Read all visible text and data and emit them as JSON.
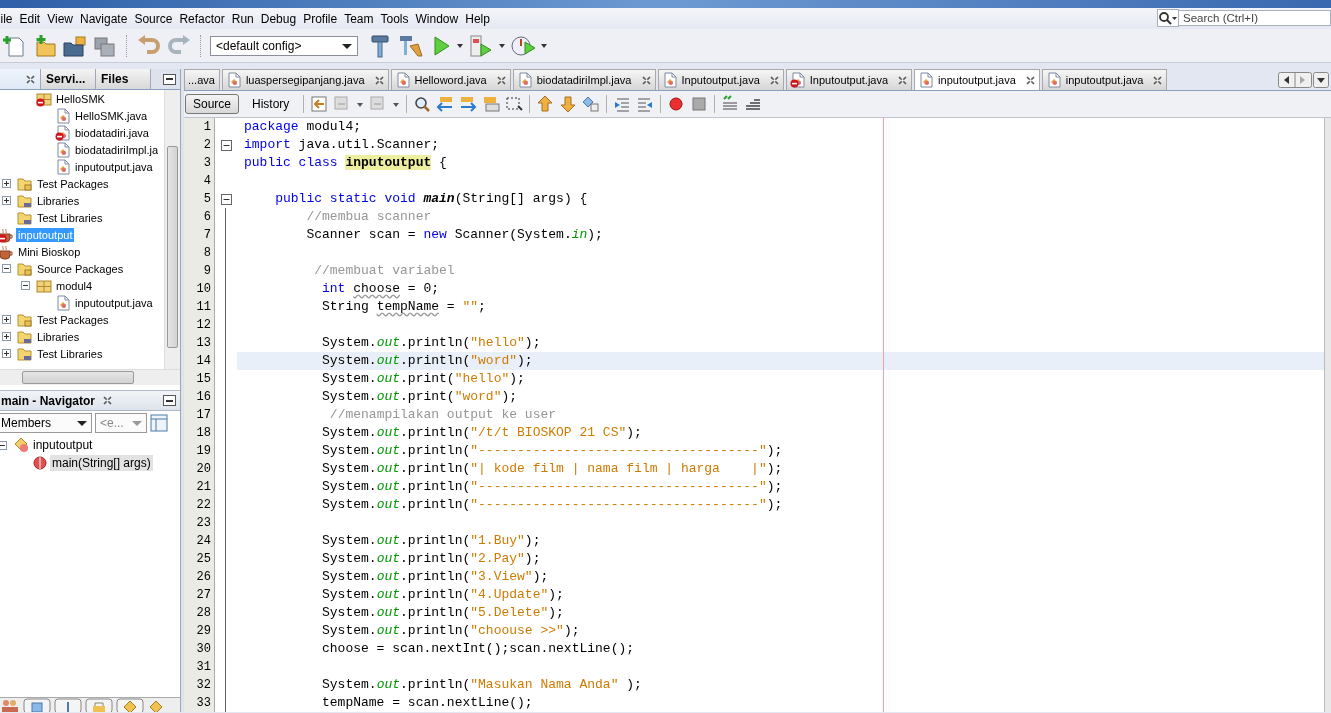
{
  "menu_bar": {
    "items": [
      "ile",
      "Edit",
      "View",
      "Navigate",
      "Source",
      "Refactor",
      "Run",
      "Debug",
      "Profile",
      "Team",
      "Tools",
      "Window",
      "Help"
    ],
    "search": {
      "placeholder": "Search (Ctrl+I)"
    }
  },
  "toolbar": {
    "config": "<default config>"
  },
  "projects_panel": {
    "tabs": [
      {
        "selected": true
      },
      {
        "label": "Servi...",
        "selected": false
      },
      {
        "label": "Files",
        "selected": false
      }
    ],
    "tree": [
      {
        "children": [
          {
            "children": [
              {
                "label": "HelloSMK",
                "kind": "package",
                "selected": false,
                "error": true,
                "children": [
                  {
                    "label": "HelloSMK.java",
                    "kind": "file",
                    "selected": false,
                    "error": false
                  },
                  {
                    "label": "biodatadiri.java",
                    "kind": "file",
                    "selected": false,
                    "error": true
                  },
                  {
                    "label": "biodatadiriImpl.ja",
                    "kind": "file",
                    "selected": false,
                    "error": false
                  },
                  {
                    "label": "inputoutput.java",
                    "kind": "file",
                    "selected": false,
                    "error": false
                  }
                ]
              }
            ]
          },
          {
            "label": "Test Packages",
            "kind": "folder",
            "expanded": false,
            "selected": false,
            "error": false
          },
          {
            "label": "Libraries",
            "kind": "library",
            "expanded": false,
            "selected": false,
            "error": false
          },
          {
            "label": "Test Libraries",
            "kind": "library",
            "selected": false,
            "error": false
          }
        ]
      },
      {
        "label": "inputoutput",
        "kind": "project",
        "selected": true,
        "error": true
      },
      {
        "label": "Mini Bioskop",
        "kind": "project",
        "selected": false,
        "error": false,
        "children": [
          {
            "label": "Source Packages",
            "kind": "folder",
            "expanded": true,
            "selected": false,
            "error": false,
            "children": [
              {
                "label": "modul4",
                "kind": "package",
                "expanded": true,
                "selected": false,
                "error": false,
                "children": [
                  {
                    "label": "inputoutput.java",
                    "kind": "file",
                    "selected": false,
                    "error": false
                  }
                ]
              }
            ]
          },
          {
            "label": "Test Packages",
            "kind": "folder",
            "expanded": false,
            "selected": false,
            "error": false
          },
          {
            "label": "Libraries",
            "kind": "library",
            "expanded": false,
            "selected": false,
            "error": false
          },
          {
            "label": "Test Libraries",
            "kind": "library",
            "expanded": false,
            "selected": false,
            "error": false
          }
        ]
      }
    ]
  },
  "navigator": {
    "title": "main - Navigator",
    "filter": "Members",
    "filter_2": "<e...",
    "tree": [
      {
        "label": "inputoutput",
        "kind": "class",
        "expanded": true,
        "selected": false,
        "error": false,
        "children": [
          {
            "label": "main(String[] args)",
            "kind": "method",
            "selected": true,
            "error": false
          }
        ]
      }
    ]
  },
  "editor": {
    "tabs": [
      {
        "label": "...ava",
        "selected": false
      },
      {
        "label": "luaspersegipanjang.java",
        "selected": false,
        "error": false
      },
      {
        "label": "Helloword.java",
        "selected": false,
        "error": false
      },
      {
        "label": "biodatadiriImpl.java",
        "selected": false,
        "error": false
      },
      {
        "label": "Inputoutput.java",
        "selected": false,
        "error": false
      },
      {
        "label": "Inputoutput.java",
        "selected": false,
        "error": true
      },
      {
        "label": "inputoutput.java",
        "selected": true,
        "error": false
      },
      {
        "label": "inputoutput.java",
        "selected": false,
        "error": false
      }
    ],
    "views": [
      {
        "label": "Source",
        "selected": true
      },
      {
        "label": "History",
        "selected": false
      }
    ],
    "lines": [
      {
        "number": "1",
        "current": false,
        "fold": false,
        "tokens": [
          {
            "kind": "keyword",
            "text": "package"
          },
          {
            "kind": "plain",
            "text": " modul4;"
          }
        ]
      },
      {
        "number": "2",
        "current": false,
        "fold": true,
        "tokens": [
          {
            "kind": "keyword",
            "text": "import"
          },
          {
            "kind": "plain",
            "text": " java.util.Scanner;"
          }
        ]
      },
      {
        "number": "3",
        "current": false,
        "fold": false,
        "tokens": [
          {
            "kind": "keyword",
            "text": "public class "
          },
          {
            "kind": "highlight",
            "text": "inputoutput"
          },
          {
            "kind": "plain",
            "text": " {"
          }
        ]
      },
      {
        "number": "4",
        "current": false,
        "fold": false
      },
      {
        "number": "5",
        "current": false,
        "fold": true,
        "tokens": [
          {
            "kind": "keyword",
            "text": "    public static void "
          },
          {
            "kind": "method",
            "text": "main"
          },
          {
            "kind": "plain",
            "text": "(String[] args) {"
          }
        ]
      },
      {
        "number": "6",
        "current": false,
        "fold": false,
        "tokens": [
          {
            "kind": "comment",
            "text": "        //membua scanner"
          }
        ]
      },
      {
        "number": "7",
        "current": false,
        "fold": false,
        "tokens": [
          {
            "kind": "plain",
            "text": "        Scanner scan = "
          },
          {
            "kind": "keyword",
            "text": "new"
          },
          {
            "kind": "plain",
            "text": " Scanner(System."
          },
          {
            "kind": "field",
            "text": "in"
          },
          {
            "kind": "plain",
            "text": ");"
          }
        ]
      },
      {
        "number": "8",
        "current": false,
        "fold": false
      },
      {
        "number": "9",
        "current": false,
        "fold": false,
        "tokens": [
          {
            "kind": "comment",
            "text": "         //membuat variabel"
          }
        ]
      },
      {
        "number": "10",
        "current": false,
        "fold": false,
        "tokens": [
          {
            "kind": "keyword",
            "text": "          int "
          },
          {
            "kind": "warning",
            "text": "choose"
          },
          {
            "kind": "plain",
            "text": " = 0;"
          }
        ]
      },
      {
        "number": "11",
        "current": false,
        "fold": false,
        "tokens": [
          {
            "kind": "plain",
            "text": "          String "
          },
          {
            "kind": "warning",
            "text": "tempName"
          },
          {
            "kind": "plain",
            "text": " = "
          },
          {
            "kind": "string",
            "text": "\"\""
          },
          {
            "kind": "plain",
            "text": ";"
          }
        ]
      },
      {
        "number": "12",
        "current": false,
        "fold": false
      },
      {
        "number": "13",
        "current": false,
        "fold": false,
        "tokens": [
          {
            "kind": "plain",
            "text": "          System."
          },
          {
            "kind": "field",
            "text": "out"
          },
          {
            "kind": "plain",
            "text": ".println("
          },
          {
            "kind": "string",
            "text": "\"hello\""
          },
          {
            "kind": "plain",
            "text": ");"
          }
        ]
      },
      {
        "number": "14",
        "current": true,
        "fold": false,
        "tokens": [
          {
            "kind": "plain",
            "text": "          System."
          },
          {
            "kind": "field",
            "text": "out"
          },
          {
            "kind": "plain",
            "text": ".println("
          },
          {
            "kind": "string",
            "text": "\"word\""
          },
          {
            "kind": "plain",
            "text": ");"
          }
        ]
      },
      {
        "number": "15",
        "current": false,
        "fold": false,
        "tokens": [
          {
            "kind": "plain",
            "text": "          System."
          },
          {
            "kind": "field",
            "text": "out"
          },
          {
            "kind": "plain",
            "text": ".print("
          },
          {
            "kind": "string",
            "text": "\"hello\""
          },
          {
            "kind": "plain",
            "text": ");"
          }
        ]
      },
      {
        "number": "16",
        "current": false,
        "fold": false,
        "tokens": [
          {
            "kind": "plain",
            "text": "          System."
          },
          {
            "kind": "field",
            "text": "out"
          },
          {
            "kind": "plain",
            "text": ".print("
          },
          {
            "kind": "string",
            "text": "\"word\""
          },
          {
            "kind": "plain",
            "text": ");"
          }
        ]
      },
      {
        "number": "17",
        "current": false,
        "fold": false,
        "tokens": [
          {
            "kind": "comment",
            "text": "           //menampilakan output ke user"
          }
        ]
      },
      {
        "number": "18",
        "current": false,
        "fold": false,
        "tokens": [
          {
            "kind": "plain",
            "text": "          System."
          },
          {
            "kind": "field",
            "text": "out"
          },
          {
            "kind": "plain",
            "text": ".println("
          },
          {
            "kind": "string",
            "text": "\"/t/t BIOSKOP 21 CS\""
          },
          {
            "kind": "plain",
            "text": ");"
          }
        ]
      },
      {
        "number": "19",
        "current": false,
        "fold": false,
        "tokens": [
          {
            "kind": "plain",
            "text": "          System."
          },
          {
            "kind": "field",
            "text": "out"
          },
          {
            "kind": "plain",
            "text": ".println("
          },
          {
            "kind": "string",
            "text": "\"------------------------------------\""
          },
          {
            "kind": "plain",
            "text": ");"
          }
        ]
      },
      {
        "number": "20",
        "current": false,
        "fold": false,
        "tokens": [
          {
            "kind": "plain",
            "text": "          System."
          },
          {
            "kind": "field",
            "text": "out"
          },
          {
            "kind": "plain",
            "text": ".println("
          },
          {
            "kind": "string",
            "text": "\"| kode film | nama film | harga    |\""
          },
          {
            "kind": "plain",
            "text": ");"
          }
        ]
      },
      {
        "number": "21",
        "current": false,
        "fold": false,
        "tokens": [
          {
            "kind": "plain",
            "text": "          System."
          },
          {
            "kind": "field",
            "text": "out"
          },
          {
            "kind": "plain",
            "text": ".println("
          },
          {
            "kind": "string",
            "text": "\"------------------------------------\""
          },
          {
            "kind": "plain",
            "text": ");"
          }
        ]
      },
      {
        "number": "22",
        "current": false,
        "fold": false,
        "tokens": [
          {
            "kind": "plain",
            "text": "          System."
          },
          {
            "kind": "field",
            "text": "out"
          },
          {
            "kind": "plain",
            "text": ".println("
          },
          {
            "kind": "string",
            "text": "\"------------------------------------\""
          },
          {
            "kind": "plain",
            "text": ");"
          }
        ]
      },
      {
        "number": "23",
        "current": false,
        "fold": false
      },
      {
        "number": "24",
        "current": false,
        "fold": false,
        "tokens": [
          {
            "kind": "plain",
            "text": "          System."
          },
          {
            "kind": "field",
            "text": "out"
          },
          {
            "kind": "plain",
            "text": ".println("
          },
          {
            "kind": "string",
            "text": "\"1.Buy\""
          },
          {
            "kind": "plain",
            "text": ");"
          }
        ]
      },
      {
        "number": "25",
        "current": false,
        "fold": false,
        "tokens": [
          {
            "kind": "plain",
            "text": "          System."
          },
          {
            "kind": "field",
            "text": "out"
          },
          {
            "kind": "plain",
            "text": ".println("
          },
          {
            "kind": "string",
            "text": "\"2.Pay\""
          },
          {
            "kind": "plain",
            "text": ");"
          }
        ]
      },
      {
        "number": "26",
        "current": false,
        "fold": false,
        "tokens": [
          {
            "kind": "plain",
            "text": "          System."
          },
          {
            "kind": "field",
            "text": "out"
          },
          {
            "kind": "plain",
            "text": ".println("
          },
          {
            "kind": "string",
            "text": "\"3.View\""
          },
          {
            "kind": "plain",
            "text": ");"
          }
        ]
      },
      {
        "number": "27",
        "current": false,
        "fold": false,
        "tokens": [
          {
            "kind": "plain",
            "text": "          System."
          },
          {
            "kind": "field",
            "text": "out"
          },
          {
            "kind": "plain",
            "text": ".println("
          },
          {
            "kind": "string",
            "text": "\"4.Update\""
          },
          {
            "kind": "plain",
            "text": ");"
          }
        ]
      },
      {
        "number": "28",
        "current": false,
        "fold": false,
        "tokens": [
          {
            "kind": "plain",
            "text": "          System."
          },
          {
            "kind": "field",
            "text": "out"
          },
          {
            "kind": "plain",
            "text": ".println("
          },
          {
            "kind": "string",
            "text": "\"5.Delete\""
          },
          {
            "kind": "plain",
            "text": ");"
          }
        ]
      },
      {
        "number": "29",
        "current": false,
        "fold": false,
        "tokens": [
          {
            "kind": "plain",
            "text": "          System."
          },
          {
            "kind": "field",
            "text": "out"
          },
          {
            "kind": "plain",
            "text": ".println("
          },
          {
            "kind": "string",
            "text": "\"choouse >>\""
          },
          {
            "kind": "plain",
            "text": ");"
          }
        ]
      },
      {
        "number": "30",
        "current": false,
        "fold": false,
        "tokens": [
          {
            "kind": "plain",
            "text": "          choose = scan.nextInt();scan.nextLine();"
          }
        ]
      },
      {
        "number": "31",
        "current": false,
        "fold": false
      },
      {
        "number": "32",
        "current": false,
        "fold": false,
        "tokens": [
          {
            "kind": "plain",
            "text": "          System."
          },
          {
            "kind": "field",
            "text": "out"
          },
          {
            "kind": "plain",
            "text": ".println("
          },
          {
            "kind": "string",
            "text": "\"Masukan Nama Anda\""
          },
          {
            "kind": "plain",
            "text": " );"
          }
        ]
      },
      {
        "number": "33",
        "current": false,
        "fold": false,
        "tokens": [
          {
            "kind": "plain",
            "text": "          tempName = scan.nextLine();"
          }
        ]
      }
    ]
  }
}
